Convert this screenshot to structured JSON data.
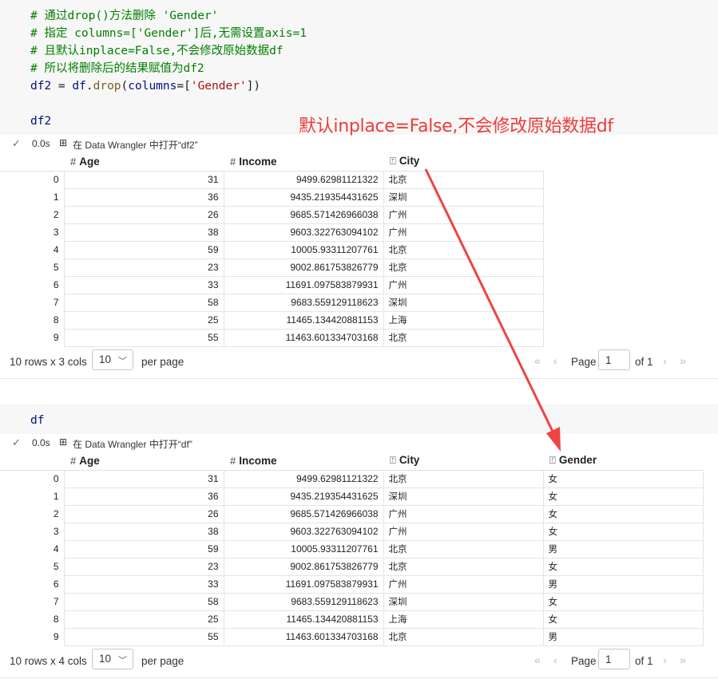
{
  "cell1": {
    "code_lines": [
      {
        "kind": "comment",
        "text": "# 通过drop()方法删除 'Gender'"
      },
      {
        "kind": "comment",
        "text": "# 指定 columns=['Gender']后,无需设置axis=1"
      },
      {
        "kind": "comment",
        "text": "# 且默认inplace=False,不会修改原始数据df"
      },
      {
        "kind": "comment",
        "text": "# 所以将删除后的结果赋值为df2"
      }
    ],
    "assign": {
      "target": "df2",
      "eq": " = ",
      "obj": "df",
      "dot": ".",
      "method": "drop",
      "open": "(",
      "kwarg": "columns",
      "kwarg_eq": "=[",
      "str": "'Gender'",
      "close": "])"
    },
    "echo": "df2",
    "annotation": "默认inplace=False,不会修改原始数据df",
    "exec_time": "0.0s",
    "dw_text": "在 Data Wrangler 中打开“df2”"
  },
  "table1": {
    "columns": [
      {
        "icon": "#",
        "name": "Age"
      },
      {
        "icon": "#",
        "name": "Income"
      },
      {
        "icon": "⍐",
        "name": "City"
      }
    ],
    "rows": [
      {
        "idx": "0",
        "age": "31",
        "income": "9499.62981121322",
        "city": "北京"
      },
      {
        "idx": "1",
        "age": "36",
        "income": "9435.219354431625",
        "city": "深圳"
      },
      {
        "idx": "2",
        "age": "26",
        "income": "9685.571426966038",
        "city": "广州"
      },
      {
        "idx": "3",
        "age": "38",
        "income": "9603.322763094102",
        "city": "广州"
      },
      {
        "idx": "4",
        "age": "59",
        "income": "10005.93311207761",
        "city": "北京"
      },
      {
        "idx": "5",
        "age": "23",
        "income": "9002.861753826779",
        "city": "北京"
      },
      {
        "idx": "6",
        "age": "33",
        "income": "11691.097583879931",
        "city": "广州"
      },
      {
        "idx": "7",
        "age": "58",
        "income": "9683.559129118623",
        "city": "深圳"
      },
      {
        "idx": "8",
        "age": "25",
        "income": "11465.134420881153",
        "city": "上海"
      },
      {
        "idx": "9",
        "age": "55",
        "income": "11463.601334703168",
        "city": "北京"
      }
    ],
    "pager": {
      "rows_info": "10 rows x 3 cols",
      "page_size": "10",
      "per_page": "per page",
      "page_label": "Page",
      "page_value": "1",
      "of_label": "of 1"
    }
  },
  "cell2": {
    "echo": "df",
    "exec_time": "0.0s",
    "dw_text": "在 Data Wrangler 中打开“df”"
  },
  "table2": {
    "columns": [
      {
        "icon": "#",
        "name": "Age"
      },
      {
        "icon": "#",
        "name": "Income"
      },
      {
        "icon": "⍐",
        "name": "City"
      },
      {
        "icon": "⍐",
        "name": "Gender"
      }
    ],
    "rows": [
      {
        "idx": "0",
        "age": "31",
        "income": "9499.62981121322",
        "city": "北京",
        "gender": "女"
      },
      {
        "idx": "1",
        "age": "36",
        "income": "9435.219354431625",
        "city": "深圳",
        "gender": "女"
      },
      {
        "idx": "2",
        "age": "26",
        "income": "9685.571426966038",
        "city": "广州",
        "gender": "女"
      },
      {
        "idx": "3",
        "age": "38",
        "income": "9603.322763094102",
        "city": "广州",
        "gender": "女"
      },
      {
        "idx": "4",
        "age": "59",
        "income": "10005.93311207761",
        "city": "北京",
        "gender": "男"
      },
      {
        "idx": "5",
        "age": "23",
        "income": "9002.861753826779",
        "city": "北京",
        "gender": "女"
      },
      {
        "idx": "6",
        "age": "33",
        "income": "11691.097583879931",
        "city": "广州",
        "gender": "男"
      },
      {
        "idx": "7",
        "age": "58",
        "income": "9683.559129118623",
        "city": "深圳",
        "gender": "女"
      },
      {
        "idx": "8",
        "age": "25",
        "income": "11465.134420881153",
        "city": "上海",
        "gender": "女"
      },
      {
        "idx": "9",
        "age": "55",
        "income": "11463.601334703168",
        "city": "北京",
        "gender": "男"
      }
    ],
    "pager": {
      "rows_info": "10 rows x 4 cols",
      "page_size": "10",
      "per_page": "per page",
      "page_label": "Page",
      "page_value": "1",
      "of_label": "of 1"
    }
  },
  "colors": {
    "comment": "#008000",
    "string": "#a31515",
    "annotation": "#ee3b3b",
    "check": "#2e8b57"
  },
  "icons": {
    "check": "check-icon",
    "data_wrangler": "data-wrangler-icon",
    "numeric_column": "hash-icon",
    "text_column": "text-type-icon",
    "first_page": "first-page-icon",
    "prev_page": "prev-page-icon",
    "next_page": "next-page-icon",
    "last_page": "last-page-icon",
    "dropdown": "chevron-down-icon"
  }
}
